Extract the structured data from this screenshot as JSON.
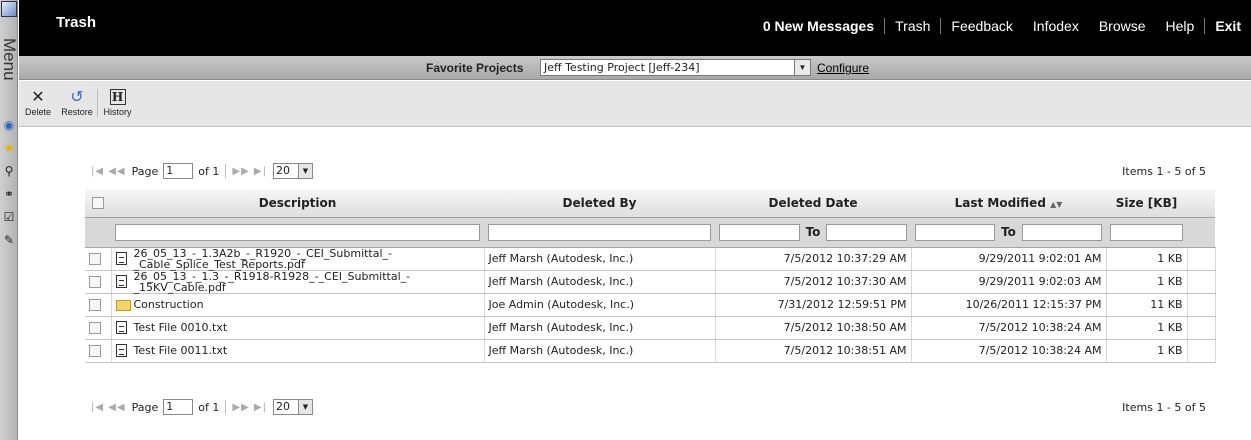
{
  "app": {
    "menu_label": "Menu",
    "page_title": "Trash"
  },
  "topnav": {
    "messages": "0 New Messages",
    "trash": "Trash",
    "feedback": "Feedback",
    "infodex": "Infodex",
    "browse": "Browse",
    "help": "Help",
    "exit": "Exit"
  },
  "favorites": {
    "label": "Favorite Projects",
    "selected": "Jeff Testing Project [Jeff-234]",
    "configure": "Configure"
  },
  "toolbar": {
    "delete": "Delete",
    "restore": "Restore",
    "history": "History"
  },
  "pager": {
    "page_label": "Page",
    "page_value": "1",
    "of_label": "of 1",
    "page_size": "20",
    "items": "Items 1 - 5 of 5"
  },
  "grid": {
    "headers": {
      "description": "Description",
      "deleted_by": "Deleted By",
      "deleted_date": "Deleted Date",
      "last_modified": "Last Modified",
      "size": "Size [KB]"
    },
    "filter_to": "To",
    "rows": [
      {
        "type": "file",
        "description": "26_05_13_-_1.3A2b_-_R1920_-_CEI_Submittal_-_Cable_Splice_Test_Reports.pdf",
        "deleted_by": "Jeff Marsh (Autodesk, Inc.)",
        "deleted_date": "7/5/2012  10:37:29 AM",
        "last_modified": "9/29/2011  9:02:01 AM",
        "size": "1 KB"
      },
      {
        "type": "file",
        "description": "26_05_13_-_1.3_-_R1918-R1928_-_CEI_Submittal_-_15KV_Cable.pdf",
        "deleted_by": "Jeff Marsh (Autodesk, Inc.)",
        "deleted_date": "7/5/2012  10:37:30 AM",
        "last_modified": "9/29/2011  9:02:03 AM",
        "size": "1 KB"
      },
      {
        "type": "folder",
        "description": "Construction",
        "deleted_by": "Joe Admin (Autodesk, Inc.)",
        "deleted_date": "7/31/2012  12:59:51 PM",
        "last_modified": "10/26/2011  12:15:37 PM",
        "size": "11 KB"
      },
      {
        "type": "file",
        "description": "Test File 0010.txt",
        "deleted_by": "Jeff Marsh (Autodesk, Inc.)",
        "deleted_date": "7/5/2012  10:38:50 AM",
        "last_modified": "7/5/2012  10:38:24 AM",
        "size": "1 KB"
      },
      {
        "type": "file",
        "description": "Test File 0011.txt",
        "deleted_by": "Jeff Marsh (Autodesk, Inc.)",
        "deleted_date": "7/5/2012  10:38:51 AM",
        "last_modified": "7/5/2012  10:38:24 AM",
        "size": "1 KB"
      }
    ]
  }
}
